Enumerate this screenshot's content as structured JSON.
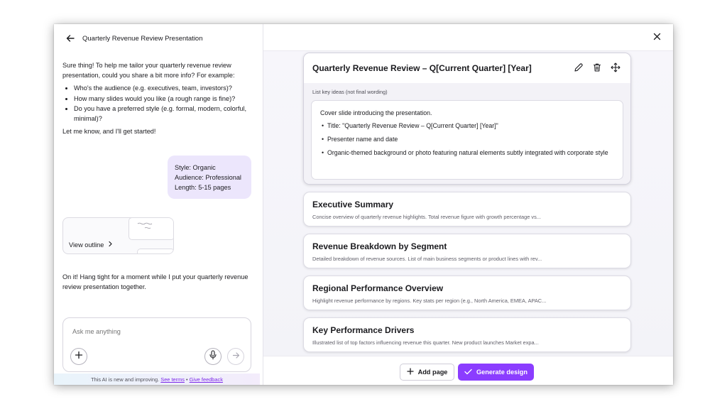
{
  "chat": {
    "title": "Quarterly Revenue Review Presentation",
    "intro": "Sure thing! To help me tailor your quarterly revenue review presentation, could you share a bit more info? For example:",
    "questions": [
      "Who's the audience (e.g. executives, team, investors)?",
      "How many slides would you like (a rough range is fine)?",
      "Do you have a preferred style (e.g. formal, modern, colorful, minimal)?"
    ],
    "closing": "Let me know, and I'll get started!",
    "user_reply": [
      "Style: Organic",
      "Audience: Professional",
      "Length: 5-15 pages"
    ],
    "view_outline_label": "View outline",
    "progress_message": "On it! Hang tight for a moment while I put your quarterly revenue review presentation together.",
    "composer_placeholder": "Ask me anything",
    "disclaimer_text": "This AI is new and improving.",
    "see_terms": "See terms",
    "separator": "•",
    "give_feedback": "Give feedback"
  },
  "outline": {
    "active": {
      "title": "Quarterly Revenue Review – Q[Current Quarter] [Year]",
      "hint": "List key ideas (not final wording)",
      "intro": "Cover slide introducing the presentation.",
      "bullets": [
        "Title: \"Quarterly Revenue Review – Q[Current Quarter] [Year]\"",
        "Presenter name and date",
        "Organic-themed background or photo featuring natural elements subtly integrated with corporate style"
      ]
    },
    "pages": [
      {
        "title": "Executive Summary",
        "desc": "Concise overview of quarterly revenue highlights. Total revenue figure with growth percentage vs..."
      },
      {
        "title": "Revenue Breakdown by Segment",
        "desc": "Detailed breakdown of revenue sources. List of main business segments or product lines with rev..."
      },
      {
        "title": "Regional Performance Overview",
        "desc": "Highlight revenue performance by regions. Key stats per region (e.g., North America, EMEA, APAC..."
      },
      {
        "title": "Key Performance Drivers",
        "desc": "Illustrated list of top factors influencing revenue this quarter. New product launches Market expa..."
      }
    ],
    "add_page_label": "Add page",
    "generate_label": "Generate design"
  },
  "icons": {
    "back": "arrow-left-icon",
    "close": "close-icon",
    "edit": "pencil-icon",
    "delete": "trash-icon",
    "move": "move-icon",
    "add": "plus-icon",
    "mic": "microphone-icon",
    "send": "arrow-right-icon",
    "chevron": "chevron-right-icon",
    "check": "check-icon"
  },
  "colors": {
    "accent": "#8b3dff",
    "bubble": "#ece6fc",
    "link": "#7d2ae8"
  }
}
